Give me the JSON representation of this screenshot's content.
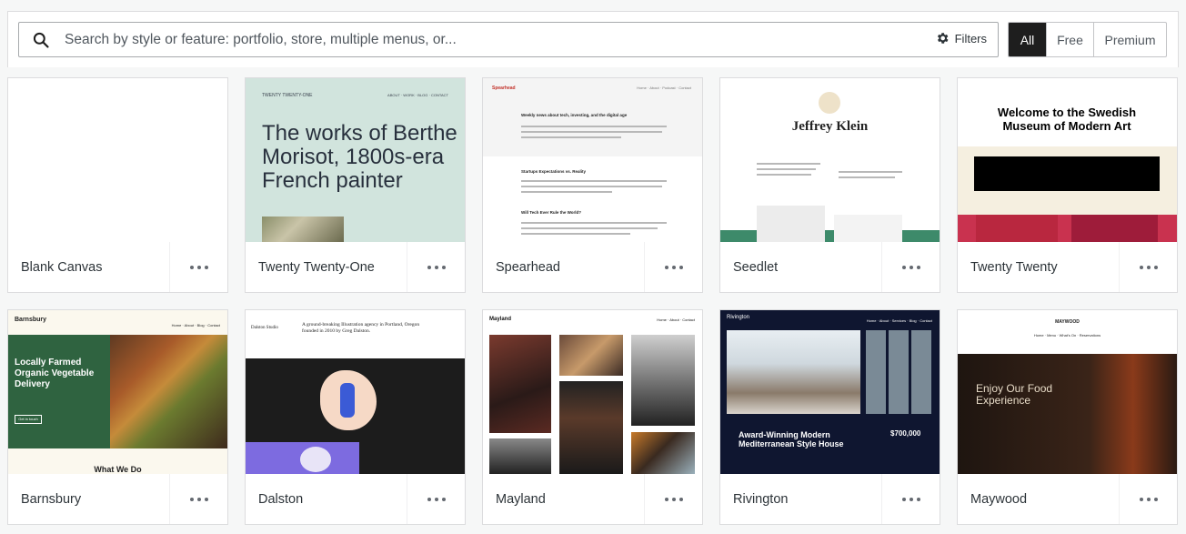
{
  "search": {
    "placeholder": "Search by style or feature: portfolio, store, multiple menus, or...",
    "filters_label": "Filters"
  },
  "tiers": {
    "all": "All",
    "free": "Free",
    "premium": "Premium",
    "selected": "All"
  },
  "themes": [
    {
      "name": "Blank Canvas"
    },
    {
      "name": "Twenty Twenty-One",
      "preview": {
        "site_title": "TWENTY TWENTY-ONE",
        "headline": "The works of Berthe Morisot, 1800s-era French painter"
      }
    },
    {
      "name": "Spearhead",
      "preview": {
        "site_title": "Spearhead",
        "h1": "Weekly news about tech, investing, and the digital age",
        "h2": "Startups Expectations vs. Reality",
        "h3": "Will Tech Ever Rule the World?"
      }
    },
    {
      "name": "Seedlet",
      "preview": {
        "site_title": "Jeffrey Klein"
      }
    },
    {
      "name": "Twenty Twenty",
      "preview": {
        "headline": "Welcome to the Swedish Museum of Modern Art"
      }
    },
    {
      "name": "Barnsbury",
      "preview": {
        "site_title": "Barnsbury",
        "headline": "Locally Farmed Organic Vegetable Delivery",
        "button": "Get in touch",
        "sub": "What We Do"
      }
    },
    {
      "name": "Dalston",
      "preview": {
        "site_title": "Dalston Studio",
        "intro": "A ground-breaking Illustration agency in Portland, Oregon founded in 2010 by Greg Dalston."
      }
    },
    {
      "name": "Mayland",
      "preview": {
        "site_title": "Mayland"
      }
    },
    {
      "name": "Rivington",
      "preview": {
        "site_title": "Rivington",
        "headline": "Award-Winning Modern Mediterranean Style House",
        "price": "$700,000"
      }
    },
    {
      "name": "Maywood",
      "preview": {
        "site_title": "MAYWOOD",
        "headline": "Enjoy Our Food Experience"
      }
    }
  ],
  "colors": {
    "accent_dark": "#1e1e1e",
    "border": "#dcdcde",
    "background": "#f6f7f7"
  }
}
